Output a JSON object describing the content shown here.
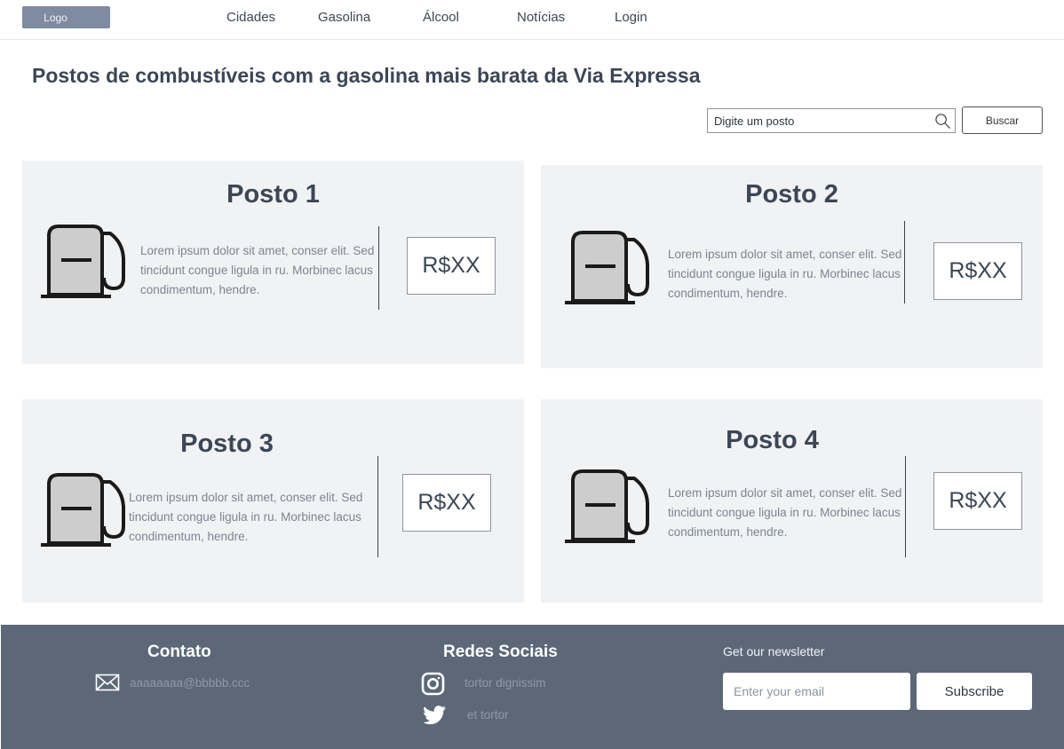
{
  "nav": {
    "logo": "Logo",
    "items": [
      "Cidades",
      "Gasolina",
      "Álcool",
      "Notícias",
      "Login"
    ]
  },
  "page_title": "Postos de combustíveis com a gasolina mais barata da Via Expressa",
  "search": {
    "placeholder": "Digite um posto",
    "button_label": "Buscar"
  },
  "cards": [
    {
      "title": "Posto 1",
      "desc": "Lorem ipsum dolor sit amet, conser elit. Sed tincidunt congue ligula in ru. Morbinec lacus condimentum, hendre.",
      "price": "R$XX"
    },
    {
      "title": "Posto 2",
      "desc": "Lorem ipsum dolor sit amet, conser elit. Sed tincidunt congue ligula in ru. Morbinec lacus condimentum, hendre.",
      "price": "R$XX"
    },
    {
      "title": "Posto 3",
      "desc": "Lorem ipsum dolor sit amet, conser elit. Sed tincidunt congue ligula in ru. Morbinec lacus condimentum, hendre.",
      "price": "R$XX"
    },
    {
      "title": "Posto 4",
      "desc": "Lorem ipsum dolor sit amet, conser elit. Sed tincidunt congue ligula in ru. Morbinec lacus condimentum, hendre.",
      "price": "R$XX"
    }
  ],
  "footer": {
    "contact": {
      "heading": "Contato",
      "email": "aaaaaaaa@bbbbb.ccc",
      "icon": "envelope-icon"
    },
    "social": {
      "heading": "Redes Sociais",
      "links": [
        {
          "icon": "instagram-icon",
          "label": "tortor dignissim"
        },
        {
          "icon": "twitter-icon",
          "label": "et tortor"
        }
      ]
    },
    "newsletter": {
      "heading": "Get our newsletter",
      "placeholder": "Enter your email",
      "button_label": "Subscribe"
    }
  },
  "colors": {
    "logo_bg": "#7f8ba0",
    "card_bg": "#f1f2f4",
    "footer_bg": "#5c6878",
    "title_text": "#3b4656"
  }
}
